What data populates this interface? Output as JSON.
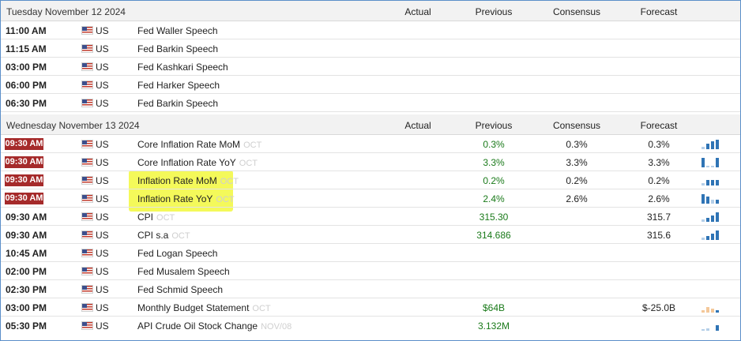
{
  "columns": {
    "actual": "Actual",
    "previous": "Previous",
    "consensus": "Consensus",
    "forecast": "Forecast"
  },
  "day1": {
    "date": "Tuesday November 12 2024",
    "rows": [
      {
        "time": "11:00 AM",
        "country": "US",
        "event": "Fed Waller Speech"
      },
      {
        "time": "11:15 AM",
        "country": "US",
        "event": "Fed Barkin Speech"
      },
      {
        "time": "03:00 PM",
        "country": "US",
        "event": "Fed Kashkari Speech"
      },
      {
        "time": "06:00 PM",
        "country": "US",
        "event": "Fed Harker Speech"
      },
      {
        "time": "06:30 PM",
        "country": "US",
        "event": "Fed Barkin Speech"
      }
    ]
  },
  "day2": {
    "date": "Wednesday November 13 2024",
    "rows": [
      {
        "time": "09:30 AM",
        "country": "US",
        "event": "Core Inflation Rate MoM",
        "period": "OCT",
        "previous": "0.3%",
        "consensus": "0.3%",
        "forecast": "0.3%"
      },
      {
        "time": "09:30 AM",
        "country": "US",
        "event": "Core Inflation Rate YoY",
        "period": "OCT",
        "previous": "3.3%",
        "consensus": "3.3%",
        "forecast": "3.3%"
      },
      {
        "time": "09:30 AM",
        "country": "US",
        "event": "Inflation Rate MoM",
        "period": "OCT",
        "previous": "0.2%",
        "consensus": "0.2%",
        "forecast": "0.2%"
      },
      {
        "time": "09:30 AM",
        "country": "US",
        "event": "Inflation Rate YoY",
        "period": "OCT",
        "previous": "2.4%",
        "consensus": "2.6%",
        "forecast": "2.6%"
      },
      {
        "time": "09:30 AM",
        "country": "US",
        "event": "CPI",
        "period": "OCT",
        "previous": "315.30",
        "consensus": "",
        "forecast": "315.7"
      },
      {
        "time": "09:30 AM",
        "country": "US",
        "event": "CPI s.a",
        "period": "OCT",
        "previous": "314.686",
        "consensus": "",
        "forecast": "315.6"
      },
      {
        "time": "10:45 AM",
        "country": "US",
        "event": "Fed Logan Speech"
      },
      {
        "time": "02:00 PM",
        "country": "US",
        "event": "Fed Musalem Speech"
      },
      {
        "time": "02:30 PM",
        "country": "US",
        "event": "Fed Schmid Speech"
      },
      {
        "time": "03:00 PM",
        "country": "US",
        "event": "Monthly Budget Statement",
        "period": "OCT",
        "previous": "$64B",
        "consensus": "",
        "forecast": "$-25.0B"
      },
      {
        "time": "05:30 PM",
        "country": "US",
        "event": "API Crude Oil Stock Change",
        "period": "NOV/08",
        "previous": "3.132M",
        "consensus": "",
        "forecast": ""
      }
    ]
  },
  "colors": {
    "highlight": "#f4f95a",
    "badge": "#a52a2a",
    "previous_text": "#1a7a1a",
    "border": "#5b8fc9",
    "spark": "#2f74b5"
  }
}
